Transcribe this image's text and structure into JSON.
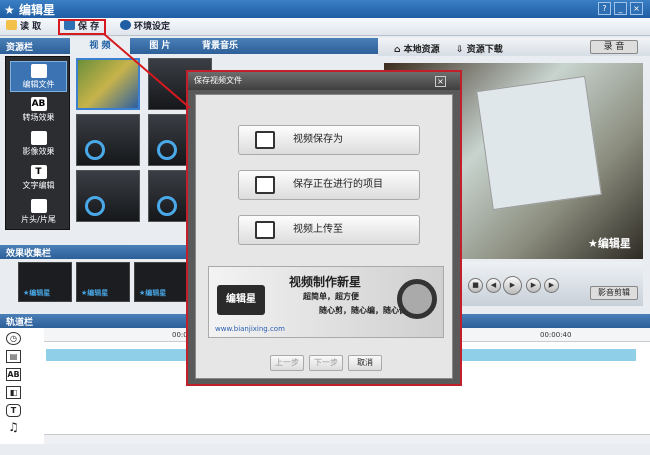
{
  "app": {
    "title": "编辑星"
  },
  "menu": {
    "import": "读 取",
    "save": "保 存",
    "settings": "环境设定"
  },
  "resource_panel": {
    "title": "资源栏",
    "tabs": [
      "视 频",
      "图 片",
      "背景音乐"
    ]
  },
  "library_buttons": [
    "编辑文件",
    "转场效果",
    "影像效果",
    "文字编辑",
    "片头/片尾"
  ],
  "library_icons": [
    "",
    "AB",
    "",
    "T",
    ""
  ],
  "effects_panel": {
    "title": "效果收集栏",
    "watermark": "★编辑星"
  },
  "preview_toolbar": {
    "local": "本地资源",
    "download": "资源下载",
    "record": "录 音"
  },
  "preview": {
    "watermark": "编辑星",
    "full_edit": "影音剪辑"
  },
  "track_panel": {
    "title": "轨道栏",
    "ruler": [
      "00:00:10",
      "00:00:40"
    ]
  },
  "dialog": {
    "title": "保存视频文件",
    "options": [
      "视频保存为",
      "保存正在进行的项目",
      "视频上传至"
    ],
    "banner": {
      "heading": "视频制作新星",
      "logo": "编辑星",
      "lines": [
        "超简单，超方便",
        "随心剪，随心编，随心做"
      ],
      "url": "www.bianjixing.com"
    },
    "buttons": {
      "prev": "上一步",
      "next": "下一步",
      "cancel": "取消"
    }
  }
}
